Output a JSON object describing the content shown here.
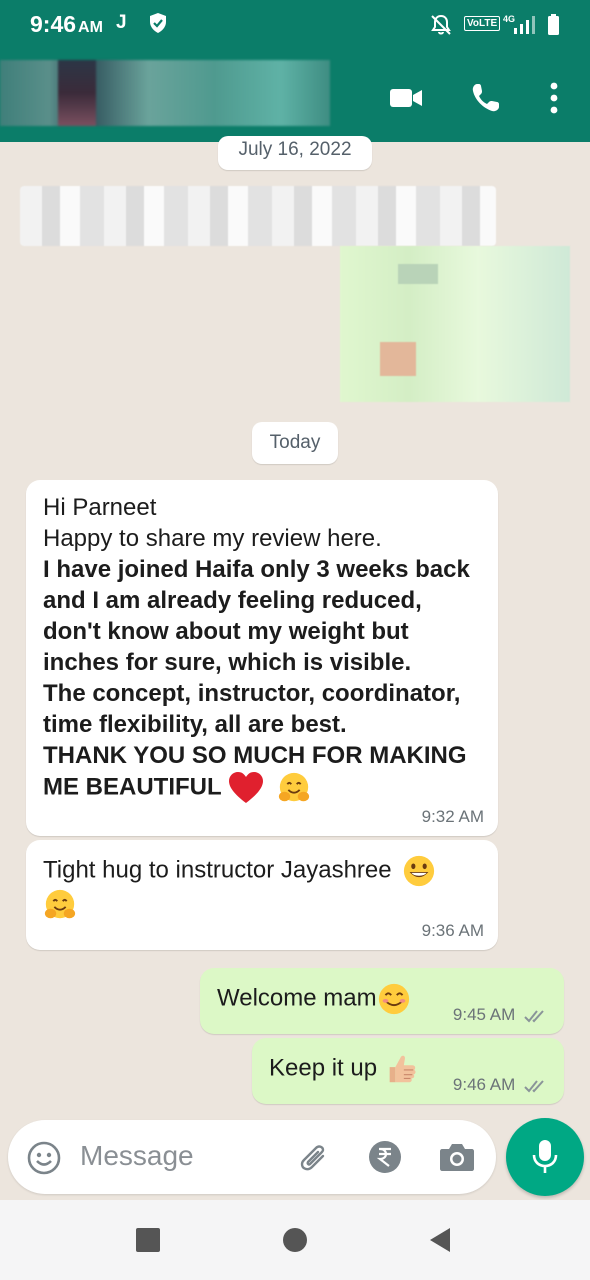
{
  "status_bar": {
    "time": "9:46",
    "ampm": "AM",
    "carrier_icon": "J",
    "volte": "VoLTE",
    "network": "4G"
  },
  "app_bar": {
    "contact_name": "",
    "icons": [
      "video-call-icon",
      "voice-call-icon",
      "more-options-icon"
    ]
  },
  "chat": {
    "date_old": "July 16, 2022",
    "date_today": "Today",
    "messages": [
      {
        "direction": "incoming",
        "lines": [
          "Hi Parneet",
          "Happy to share my review here."
        ],
        "bold_lines": [
          "I have joined Haifa only 3 weeks back",
          "and I am already feeling reduced,",
          "don't know about my weight but",
          "inches for sure, which is visible.",
          "The concept, instructor, coordinator,",
          "time flexibility, all are best.",
          "THANK YOU SO MUCH FOR MAKING",
          "ME BEAUTIFUL"
        ],
        "time": "9:32 AM"
      },
      {
        "direction": "incoming",
        "text": "Tight hug to instructor Jayashree",
        "time": "9:36 AM"
      },
      {
        "direction": "outgoing",
        "text": "Welcome mam",
        "time": "9:45 AM"
      },
      {
        "direction": "outgoing",
        "text": "Keep it up",
        "time": "9:46 AM"
      }
    ]
  },
  "input_bar": {
    "placeholder": "Message"
  },
  "colors": {
    "header": "#0b7d69",
    "chat_background": "#ece5dd",
    "incoming_bubble": "#ffffff",
    "outgoing_bubble": "#dcf8c6",
    "mic_button": "#00a884"
  }
}
